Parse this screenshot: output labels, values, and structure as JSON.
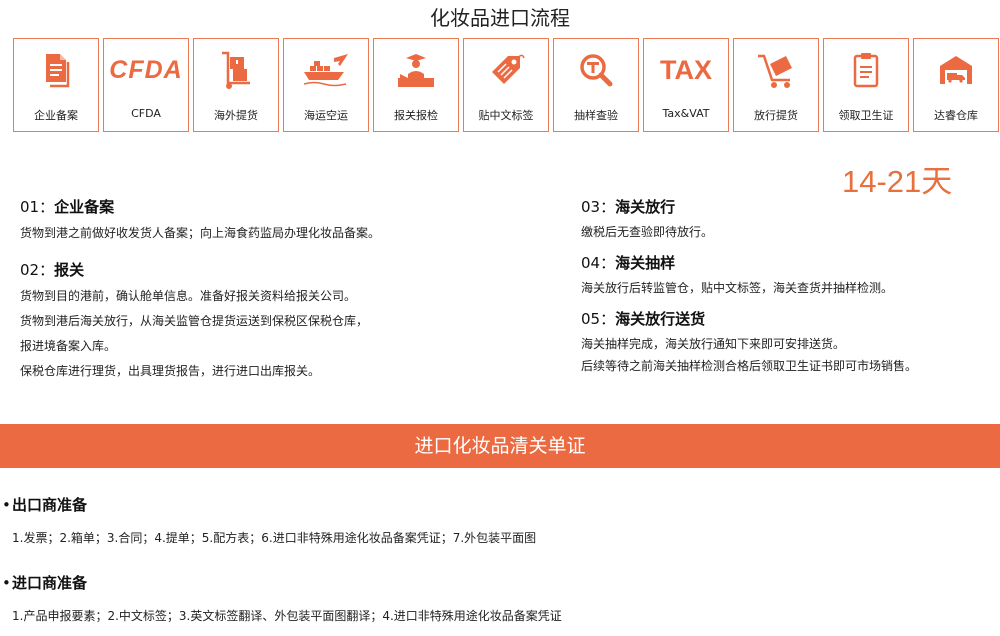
{
  "page_title": "化妆品进口流程",
  "steps": [
    {
      "label": "企业备案",
      "icon": "document-icon"
    },
    {
      "label": "CFDA",
      "icon": "cfda-logo-icon",
      "text": "CFDA"
    },
    {
      "label": "海外提货",
      "icon": "hand-truck-icon"
    },
    {
      "label": "海运空运",
      "icon": "ship-plane-icon"
    },
    {
      "label": "报关报检",
      "icon": "customs-officer-icon"
    },
    {
      "label": "贴中文标签",
      "icon": "tag-icon"
    },
    {
      "label": "抽样查验",
      "icon": "magnifier-icon"
    },
    {
      "label": "Tax&VAT",
      "icon": "tax-icon",
      "text": "TAX"
    },
    {
      "label": "放行提货",
      "icon": "cart-icon"
    },
    {
      "label": "领取卫生证",
      "icon": "clipboard-icon"
    },
    {
      "label": "达睿仓库",
      "icon": "warehouse-icon"
    }
  ],
  "duration": "14-21天",
  "left_sections": [
    {
      "num": "01：",
      "title": "企业备案",
      "lines": [
        "货物到港之前做好收发货人备案；向上海食药监局办理化妆品备案。"
      ]
    },
    {
      "num": "02：",
      "title": "报关",
      "lines": [
        "货物到目的港前，确认舱单信息。准备好报关资料给报关公司。",
        "货物到港后海关放行，从海关监管仓提货运送到保税区保税仓库，",
        "报进境备案入库。",
        "保税仓库进行理货，出具理货报告，进行进口出库报关。"
      ]
    }
  ],
  "right_sections": [
    {
      "num": "03：",
      "title": "海关放行",
      "lines": [
        "缴税后无查验即待放行。"
      ]
    },
    {
      "num": "04：",
      "title": "海关抽样",
      "lines": [
        "海关放行后转监管仓，贴中文标签，海关查货并抽样检测。"
      ]
    },
    {
      "num": "05：",
      "title": "海关放行送货",
      "lines": [
        "海关抽样完成，海关放行通知下来即可安排送货。",
        "后续等待之前海关抽样检测合格后领取卫生证书即可市场销售。"
      ]
    }
  ],
  "banner": "进口化妆品清关单证",
  "docs": [
    {
      "bullet": "•",
      "title": "出口商准备",
      "text": "1.发票；2.箱单；3.合同；4.提单；5.配方表；6.进口非特殊用途化妆品备案凭证；7.外包装平面图"
    },
    {
      "bullet": "•",
      "title": "进口商准备",
      "text": "1.产品申报要素；2.中文标签；3.英文标签翻译、外包装平面图翻译；4.进口非特殊用途化妆品备案凭证"
    }
  ],
  "colors": {
    "accent": "#ec6a41",
    "border": "#ec7a55",
    "duration": "#e8703f"
  }
}
